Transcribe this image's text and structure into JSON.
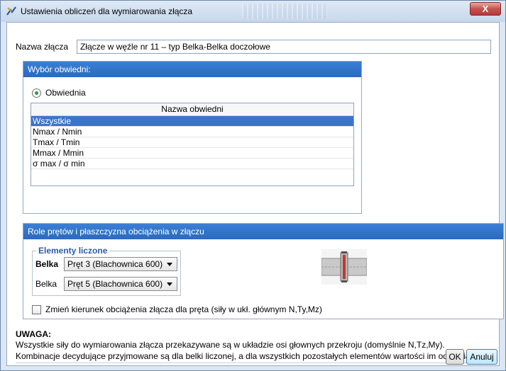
{
  "window": {
    "title": "Ustawienia obliczeń dla wymiarowania złącza",
    "close_label": "X"
  },
  "name_row": {
    "label": "Nazwa złącza",
    "value": "Złącze w węźle nr 11 – typ Belka-Belka doczołowe"
  },
  "envelope_panel": {
    "title": "Wybór obwiedni:",
    "radio_label": "Obwiednia",
    "table_header": "Nazwa obwiedni",
    "rows": [
      "Wszystkie",
      "Nmax / Nmin",
      "Tmax / Tmin",
      "Mmax / Mmin",
      "σ max / σ min"
    ],
    "selected_index": 0
  },
  "roles_panel": {
    "title": "Role prętów i płaszczyzna obciążenia w złączu",
    "group_legend": "Elementy liczone",
    "beam_rows": [
      {
        "label": "Belka",
        "value": "Pręt 3 (Blachownica 600)",
        "bold": true
      },
      {
        "label": "Belka",
        "value": "Pręt 5 (Blachownica 600)",
        "bold": false
      }
    ],
    "checkbox_label": "Zmień kierunek obciążenia złącza dla pręta (siły w ukł. głównym N,Ty,Mz)",
    "checkbox_checked": false
  },
  "warning": {
    "title": "UWAGA:",
    "line1": "Wszystkie siły do wymiarowania złącza przekazywane są w układzie osi głownych przekroju (domyślnie N,Tz,My).",
    "line2": "Kombinacje decydujące przyjmowane są dla belki liczonej, a dla wszystkich pozostałych elementów wartości im odpowiadające."
  },
  "buttons": {
    "ok": "OK",
    "cancel": "Anuluj"
  },
  "colors": {
    "panel_header": "#2b6ac0",
    "selection": "#3c74c9",
    "legend_text": "#2a5aa8",
    "close_button": "#c75050"
  }
}
